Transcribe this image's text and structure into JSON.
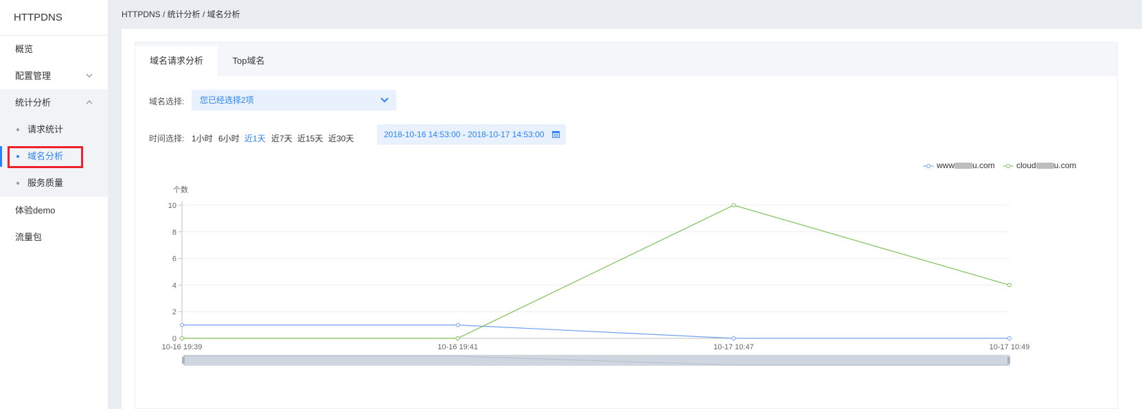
{
  "sidebar": {
    "brand": "HTTPDNS",
    "items": [
      {
        "label": "概览"
      },
      {
        "label": "配置管理",
        "chevron": "chevron-down"
      },
      {
        "label": "统计分析",
        "chevron": "chevron-up"
      }
    ],
    "sub_items": [
      {
        "label": "请求统计"
      },
      {
        "label": "域名分析",
        "active": true
      },
      {
        "label": "服务质量"
      }
    ],
    "bottom_items": [
      {
        "label": "体验demo"
      },
      {
        "label": "流量包"
      }
    ],
    "accent_color": "#2b82ff",
    "highlight_color": "#f0202a"
  },
  "breadcrumb": "HTTPDNS / 统计分析 / 域名分析",
  "tabs": [
    {
      "label": "域名请求分析",
      "active": true
    },
    {
      "label": "Top域名",
      "active": false
    }
  ],
  "domain_select": {
    "label": "域名选择:",
    "value": "您已经选择2项",
    "icon": "chevron-down-icon"
  },
  "time_select": {
    "label": "时间选择:",
    "options": [
      "1小时",
      "6小时",
      "近1天",
      "近7天",
      "近15天",
      "近30天"
    ],
    "active_index": 2,
    "range": "2018-10-16 14:53:00 - 2018-10-17 14:53:00",
    "range_icon": "calendar-icon"
  },
  "chart_data": {
    "type": "line",
    "ylabel": "个数",
    "ylim": [
      0,
      10
    ],
    "yticks": [
      0,
      2,
      4,
      6,
      8,
      10
    ],
    "categories": [
      "10-16 19:39",
      "10-16 19:41",
      "10-17 10:47",
      "10-17 10:49"
    ],
    "series": [
      {
        "name": "www",
        "name_suffix": "u.com",
        "color": "#6f9ff2",
        "values": [
          1,
          1,
          0,
          0
        ]
      },
      {
        "name": "cloud",
        "name_suffix": "u.com",
        "color": "#7cc154",
        "values": [
          0,
          0,
          10,
          4
        ]
      }
    ],
    "legend_position": "top-right",
    "grid": true,
    "datazoom": true
  }
}
